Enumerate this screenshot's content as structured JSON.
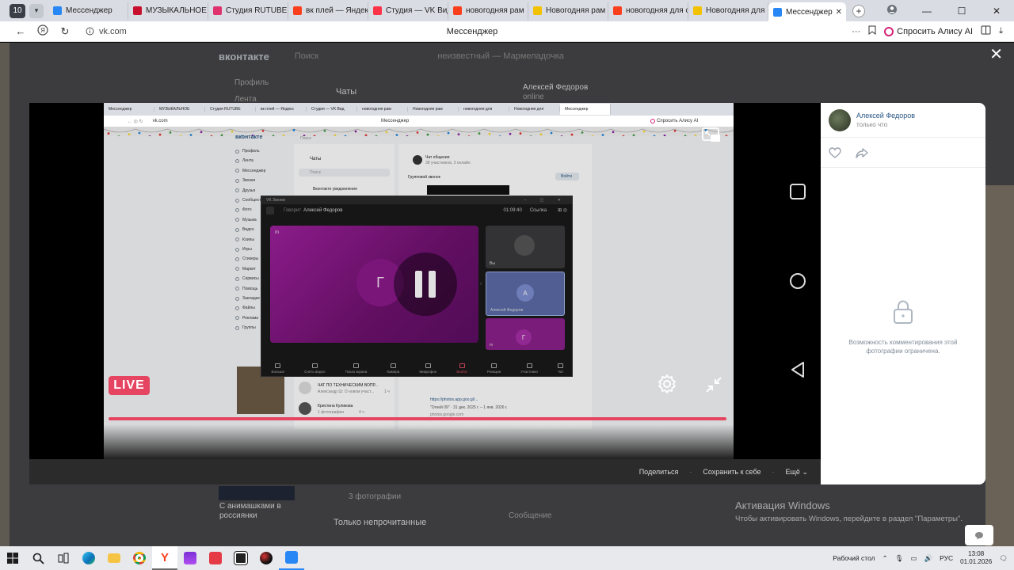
{
  "browser": {
    "tab_count": "10",
    "tabs": [
      {
        "label": "Мессенджер",
        "color": "#2787f5"
      },
      {
        "label": "МУЗЫКАЛЬНОЕ",
        "color": "#c8102e"
      },
      {
        "label": "Студия RUTUBE",
        "color": "#e0336e"
      },
      {
        "label": "вк плей — Яндекс",
        "color": "#fc3f1d"
      },
      {
        "label": "Студия — VK Вид",
        "color": "#ff3347"
      },
      {
        "label": "новогодняя рам",
        "color": "#fc3f1d"
      },
      {
        "label": "Новогодняя рам",
        "color": "#f2c200"
      },
      {
        "label": "новогодняя для с",
        "color": "#fc3f1d"
      },
      {
        "label": "Новогодняя для",
        "color": "#f2c200"
      },
      {
        "label": "Мессенджер",
        "color": "#2787f5",
        "active": true
      }
    ],
    "new_tab": "+",
    "url": "vk.com",
    "page_title": "Мессенджер",
    "alice_label": "Спросить Алису AI",
    "more": "···"
  },
  "background_page": {
    "logo": "вконтакте",
    "search_placeholder": "Поиск",
    "player_track": "неизвестный — Мармеладочка",
    "nav_profile": "Профиль",
    "nav_feed": "Лента",
    "chats_title": "Чаты",
    "contact_name": "Алексей Федоров",
    "contact_status": "online",
    "post_title": "С анимашками в",
    "post_sub": "россиянки",
    "photos_count": "3 фотографии",
    "unread_only": "Только непрочитанные",
    "message_placeholder": "Сообщение"
  },
  "inner_screenshot": {
    "tabs": [
      "Мессенджер",
      "МУЗЫКАЛЬНОЕ",
      "Студия RUTUBE",
      "вк плей — Яндекс",
      "Студия — VK Вид",
      "новогодняя рам",
      "Новогодняя рам",
      "новогодняя для",
      "Новогодняя для",
      "Мессенджер"
    ],
    "url": "vk.com",
    "page_title": "Мессенджер",
    "alice_label": "Спросить Алису AI",
    "logo": "вконтакте",
    "search": "Поиск",
    "nav": [
      "Профиль",
      "Лента",
      "Мессенджер",
      "Звонки",
      "Друзья",
      "Сообщества",
      "Фото",
      "Музыка",
      "Видео",
      "Клипы",
      "Игры",
      "Стикеры",
      "Маркет",
      "Сервисы",
      "Помощь",
      "Закладки",
      "Файлы",
      "Реклама",
      "Группы"
    ],
    "chats_title": "Чаты",
    "chat_search": "Поиск",
    "chat_item": "Вконтакте уведомления",
    "group_name": "Чат общения",
    "group_sub": "38 участников, 3 онлайн",
    "group_call": "Групповой звонок",
    "join": "Войти",
    "chat_tech": "ЧАТ ПО ТЕХНИЧЕСКИМ ВОПР...",
    "chat_tech_msg": "Александр Ш: О новом участ...",
    "chat_tech_time": "1 ч",
    "chat_kristina": "Кристина Куликова",
    "chat_kristina_msg": "1 фотография",
    "chat_kristina_time": "4 ч",
    "msg_link": "https://photos.app.goo.gl/...",
    "msg_date": "\"Огней 09\" · 31 дек. 2025 г. – 1 янв. 2026 г.",
    "msg_domain": "photos.google.com",
    "call": {
      "window_title": "VK Звонки",
      "speaking": "Говорит",
      "speaker": "Алексей Федоров",
      "timer": "01:09:40",
      "link": "Ссылка",
      "main_badge": "m",
      "main_letter": "Г",
      "tile_you": "Вы",
      "tile_alexey_letter": "А",
      "tile_alexey": "Алексей Федоров",
      "tile_g_letter": "Г",
      "tile_m": "m",
      "toolbar": [
        "Больше",
        "Снять видео",
        "Показ экрана",
        "Камера",
        "Микрофон",
        "Выйти",
        "Реакции",
        "Участники",
        "Чат"
      ]
    }
  },
  "video": {
    "live_label": "LIVE",
    "progress": 1.0,
    "accent": "#e54560"
  },
  "viewer_footer": {
    "share": "Поделиться",
    "save": "Сохранить к себе",
    "more": "Ещё"
  },
  "side_panel": {
    "author": "Алексей Федоров",
    "time": "только что",
    "restricted_message": "Возможность комментирования этой фотографии ограничена."
  },
  "activation": {
    "title": "Активация Windows",
    "subtitle": "Чтобы активировать Windows, перейдите в раздел \"Параметры\"."
  },
  "taskbar": {
    "desktop_label": "Рабочий стол",
    "lang": "РУС",
    "time": "13:08",
    "date": "01.01.2026"
  }
}
